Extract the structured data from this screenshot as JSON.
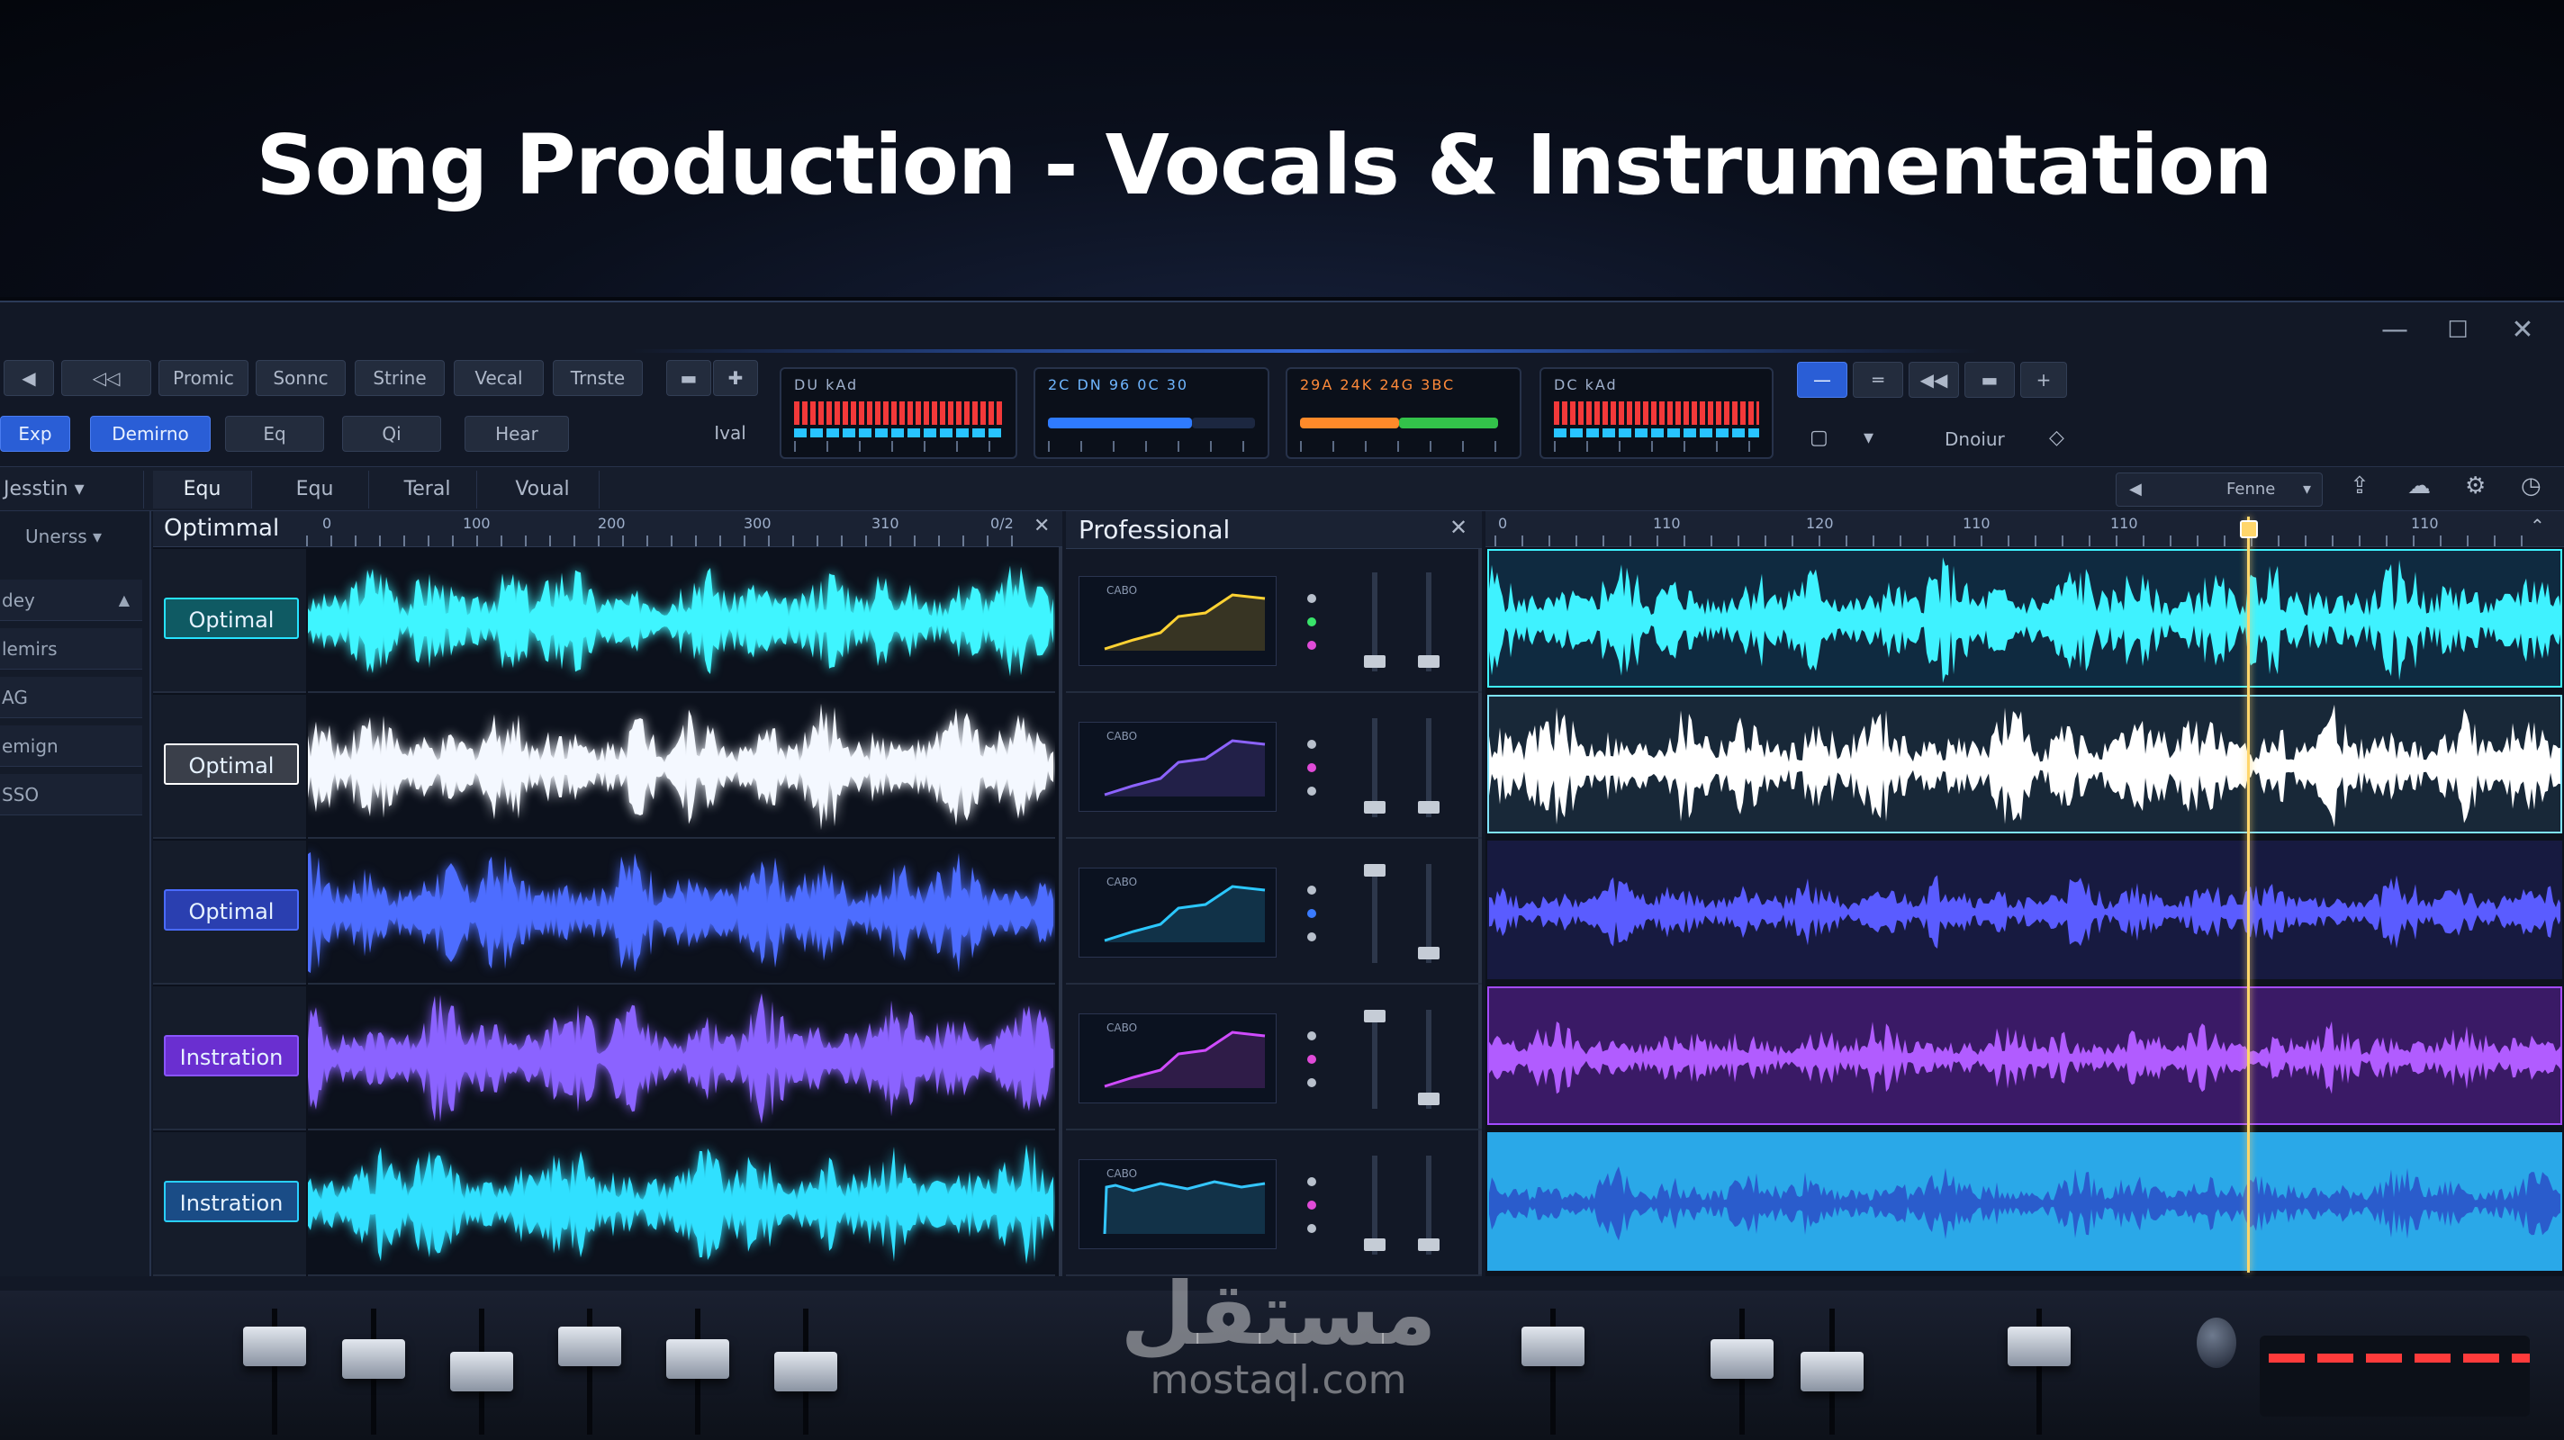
{
  "page": {
    "title": "Song Production - Vocals & Instrumentation"
  },
  "window_controls": {
    "minimize": "—",
    "maximize": "☐",
    "close": "✕"
  },
  "toolbar": {
    "row1": [
      "◀",
      "◁◁",
      "▶|",
      "Promic",
      "Sonnc",
      "Strine",
      "Vecal",
      "Trnste"
    ],
    "row2": [
      "Exp",
      "Demirno",
      "Eq",
      "Qi",
      "Hear",
      "Ival"
    ],
    "meters": [
      {
        "label": "DU   kAd",
        "kind": "red"
      },
      {
        "label": "2C  DN  96  0C  30",
        "kind": "blue"
      },
      {
        "label": "29A  24K  24G  3BC",
        "kind": "orange"
      },
      {
        "label": "DC   kAd",
        "kind": "red"
      }
    ],
    "right_buttons": [
      "—",
      "═",
      "◀◀",
      "▬",
      "+"
    ],
    "right_row2": [
      "▢",
      "▾",
      "Dnoiur",
      "◇"
    ]
  },
  "subtoolbar": {
    "tabs": [
      "Equ",
      "Equ",
      "Teral",
      "Voual"
    ],
    "left_select": "Jesstin",
    "right_select": "Fenne",
    "icons": [
      "upload-icon",
      "cloud-icon",
      "settings-icon",
      "clock-icon"
    ]
  },
  "sidebar": {
    "select": "Unerss",
    "items": [
      "dey",
      "lemirs",
      "AG",
      "emign",
      "SSO"
    ]
  },
  "tracks_panel": {
    "title": "Optimmal",
    "ruler": [
      "0",
      "100",
      "200",
      "300",
      "310",
      "0/2"
    ],
    "tracks": [
      {
        "label": "Optimal",
        "color": "#26e3ff",
        "btn_bg": "#0f5a63",
        "wave": "#3ff5ff"
      },
      {
        "label": "Optimal",
        "color": "#ffffff",
        "btn_bg": "#3a3f4a",
        "wave": "#f4f8ff"
      },
      {
        "label": "Optimal",
        "color": "#4a6bff",
        "btn_bg": "#2a3fb0",
        "wave": "#4d6dff"
      },
      {
        "label": "Instration",
        "color": "#8a55ff",
        "btn_bg": "#6a2fd0",
        "wave": "#8b63ff"
      },
      {
        "label": "Instration",
        "color": "#29d0ff",
        "btn_bg": "#1a4c86",
        "wave": "#30e0ff"
      }
    ]
  },
  "mixer_panel": {
    "title": "Professional",
    "close": "✕",
    "rows": [
      {
        "label": "CABO",
        "line": "#ffd233",
        "dots": [
          "#b8c0cc",
          "#39e36a",
          "#e04bd8"
        ]
      },
      {
        "label": "CABO",
        "line": "#8c63ff",
        "dots": [
          "#b8c0cc",
          "#e04bd8",
          "#b8c0cc"
        ]
      },
      {
        "label": "CABO",
        "line": "#2bc8ff",
        "dots": [
          "#b8c0cc",
          "#3a7bff",
          "#b8c0cc"
        ]
      },
      {
        "label": "CABO",
        "line": "#d04bff",
        "dots": [
          "#b8c0cc",
          "#e04bd8",
          "#b8c0cc"
        ]
      },
      {
        "label": "CABO",
        "line": "#34c6ff",
        "dots": [
          "#b8c0cc",
          "#e04bd8",
          "#b8c0cc"
        ]
      }
    ]
  },
  "arrange_panel": {
    "ruler": [
      "0",
      "110",
      "120",
      "110",
      "110",
      "110"
    ],
    "lanes": [
      {
        "bg": "#0f2a40",
        "wave": "#3ff2ff",
        "border": "#3ff2ff"
      },
      {
        "bg": "#182838",
        "wave": "#ffffff",
        "border": "#7fe3ff"
      },
      {
        "bg": "#171a40",
        "wave": "#5a5cff",
        "border": "#171a40"
      },
      {
        "bg": "#3a1a66",
        "wave": "#b15cff",
        "border": "#a44bff"
      },
      {
        "bg": "#2aa8e8",
        "wave": "#2a5ccc",
        "border": "#2aa8e8"
      }
    ]
  },
  "watermark": {
    "arabic": "مستقل",
    "latin": "mostaql.com"
  }
}
